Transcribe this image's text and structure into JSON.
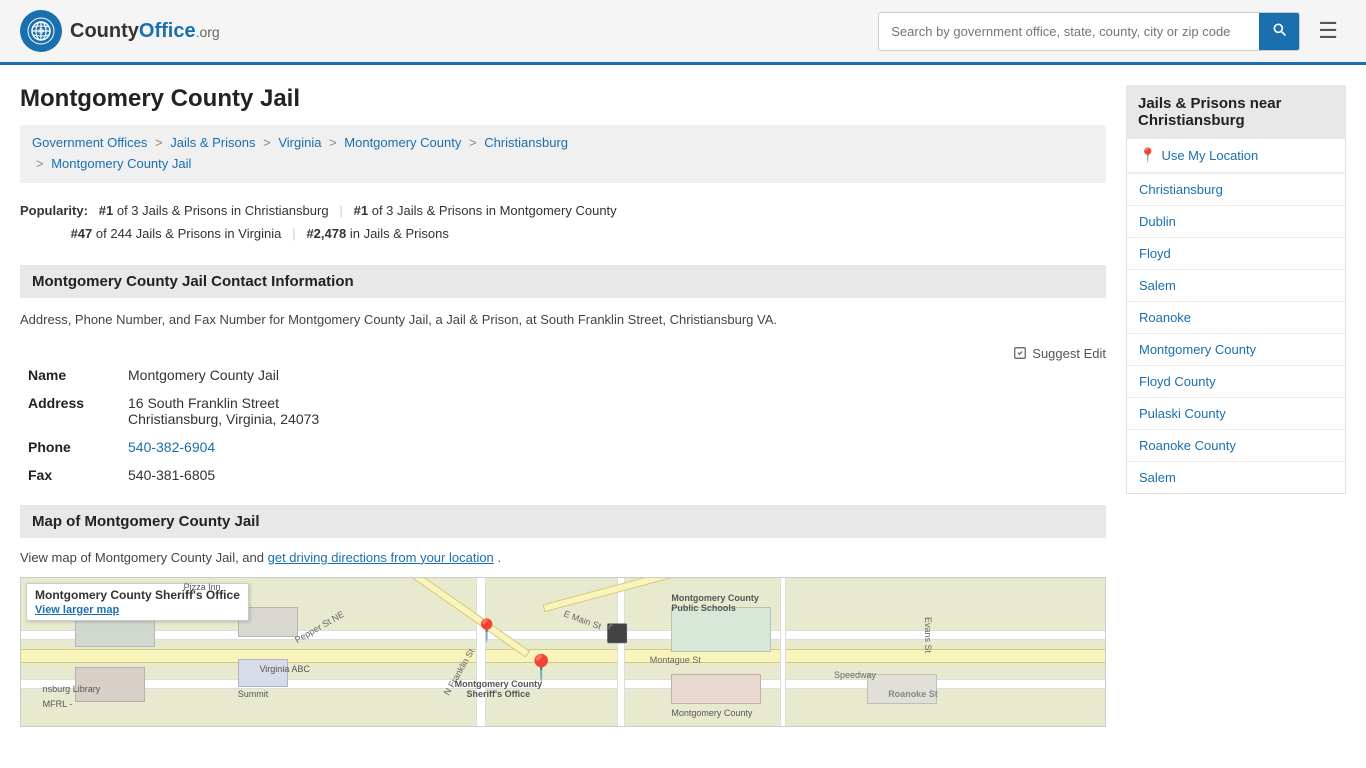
{
  "site": {
    "logo_text": "CountyOffice",
    "logo_ext": ".org",
    "search_placeholder": "Search by government office, state, county, city or zip code"
  },
  "page": {
    "title": "Montgomery County Jail"
  },
  "breadcrumb": {
    "items": [
      {
        "label": "Government Offices",
        "href": "#"
      },
      {
        "label": "Jails & Prisons",
        "href": "#"
      },
      {
        "label": "Virginia",
        "href": "#"
      },
      {
        "label": "Montgomery County",
        "href": "#"
      },
      {
        "label": "Christiansburg",
        "href": "#"
      },
      {
        "label": "Montgomery County Jail",
        "href": "#"
      }
    ]
  },
  "popularity": {
    "label": "Popularity:",
    "rank1": "#1",
    "rank1_text": "of 3 Jails & Prisons in Christiansburg",
    "rank2": "#1",
    "rank2_text": "of 3 Jails & Prisons in Montgomery County",
    "rank3": "#47",
    "rank3_text": "of 244 Jails & Prisons in Virginia",
    "rank4": "#2,478",
    "rank4_text": "in Jails & Prisons"
  },
  "contact": {
    "section_title": "Montgomery County Jail Contact Information",
    "description": "Address, Phone Number, and Fax Number for Montgomery County Jail, a Jail & Prison, at South Franklin Street, Christiansburg VA.",
    "suggest_edit": "Suggest Edit",
    "fields": {
      "name_label": "Name",
      "name_value": "Montgomery County Jail",
      "address_label": "Address",
      "address_line1": "16 South Franklin Street",
      "address_line2": "Christiansburg, Virginia, 24073",
      "phone_label": "Phone",
      "phone_value": "540-382-6904",
      "fax_label": "Fax",
      "fax_value": "540-381-6805"
    }
  },
  "map_section": {
    "section_title": "Map of Montgomery County Jail",
    "description_before": "View map of Montgomery County Jail, and",
    "map_link_text": "get driving directions from your location",
    "description_after": ".",
    "map_label_title": "Montgomery County Sheriff's Office",
    "map_label_link": "View larger map"
  },
  "sidebar": {
    "header": "Jails & Prisons near Christiansburg",
    "use_location": "Use My Location",
    "links": [
      {
        "label": "Christiansburg",
        "href": "#"
      },
      {
        "label": "Dublin",
        "href": "#"
      },
      {
        "label": "Floyd",
        "href": "#"
      },
      {
        "label": "Salem",
        "href": "#"
      },
      {
        "label": "Roanoke",
        "href": "#"
      },
      {
        "label": "Montgomery County",
        "href": "#"
      },
      {
        "label": "Floyd County",
        "href": "#"
      },
      {
        "label": "Pulaski County",
        "href": "#"
      },
      {
        "label": "Roanoke County",
        "href": "#"
      },
      {
        "label": "Salem",
        "href": "#"
      }
    ]
  }
}
